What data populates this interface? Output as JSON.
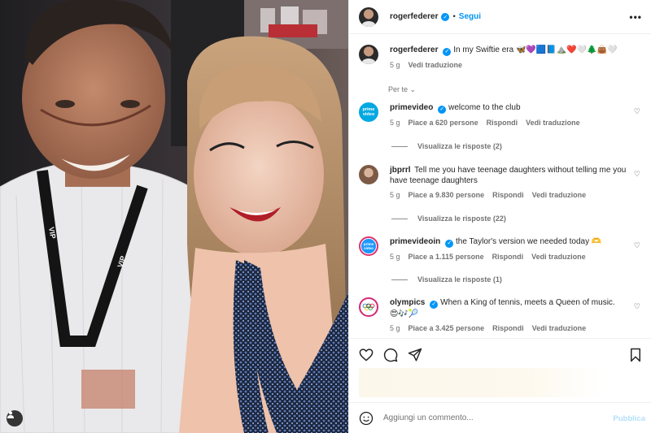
{
  "header": {
    "username": "rogerfederer",
    "follow_label": "Segui",
    "more_label": "•••"
  },
  "caption": {
    "username": "rogerfederer",
    "text": "In my Swiftie era 🦋💜🟦📘⛰️❤️🤍🌲👜🤍",
    "time": "5 g",
    "translate_label": "Vedi traduzione"
  },
  "for_you_label": "Per te ⌄",
  "comments": [
    {
      "username": "primevideo",
      "verified": true,
      "text": "welcome to the club",
      "time": "5 g",
      "likes": "Piace a 620 persone",
      "reply_label": "Rispondi",
      "translate_label": "Vedi traduzione",
      "replies_label": "Visualizza le risposte (2)",
      "avatar_text": "prime video"
    },
    {
      "username": "jbprrl",
      "verified": false,
      "text": "Tell me you have teenage daughters without telling me you have teenage daughters",
      "time": "5 g",
      "likes": "Piace a 9.830 persone",
      "reply_label": "Rispondi",
      "translate_label": "Vedi traduzione",
      "replies_label": "Visualizza le risposte (22)"
    },
    {
      "username": "primevideoin",
      "verified": true,
      "text": "the Taylor's version we needed today 🫶",
      "time": "5 g",
      "likes": "Piace a 1.115 persone",
      "reply_label": "Rispondi",
      "translate_label": "Vedi traduzione",
      "replies_label": "Visualizza le risposte (1)",
      "avatar_text": "prime video"
    },
    {
      "username": "olympics",
      "verified": true,
      "text": "When a King of tennis, meets a Queen of music.",
      "text_line2": "😍🎶🎾",
      "time": "5 g",
      "likes": "Piace a 3.425 persone",
      "reply_label": "Rispondi",
      "translate_label": "Vedi traduzione"
    }
  ],
  "composer": {
    "placeholder": "Aggiungi un commento...",
    "publish_label": "Pubblica"
  },
  "photo": {
    "lanyard_text": "VIP"
  },
  "icons": {
    "like": "heart-icon",
    "comment": "comment-icon",
    "share": "share-icon",
    "save": "bookmark-icon",
    "emoji": "emoji-icon",
    "tag": "user-tag-icon"
  },
  "colors": {
    "accent": "#0095f6",
    "muted": "#737373",
    "publish_disabled": "#b2dffc"
  }
}
